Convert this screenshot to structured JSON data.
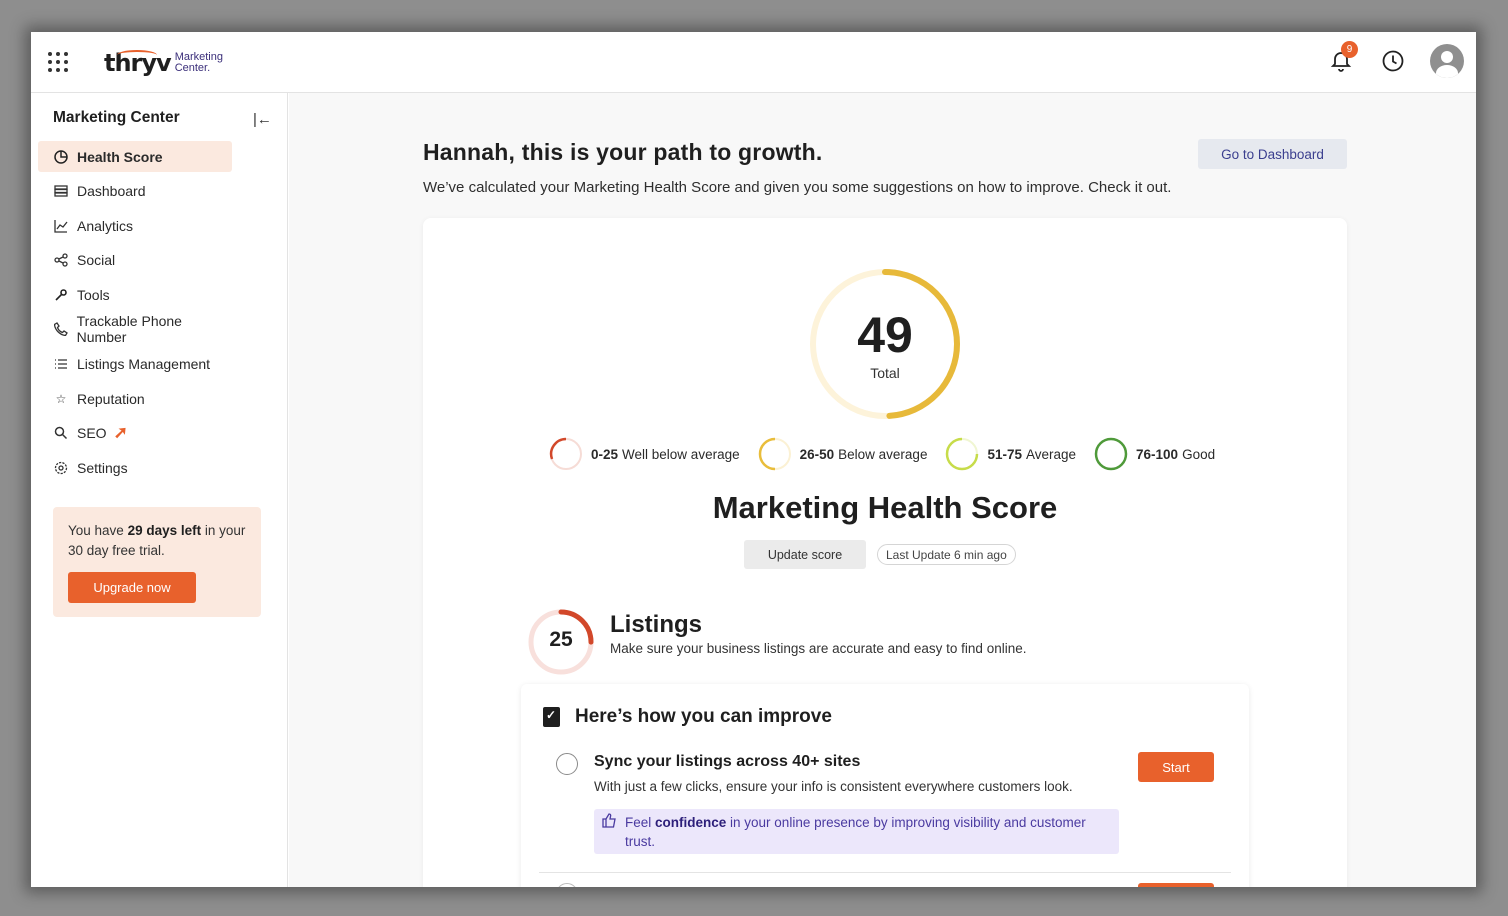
{
  "topbar": {
    "logo_word": "thryv",
    "logo_sub_1": "Marketing",
    "logo_sub_2": "Center.",
    "notification_count": "9",
    "icons": [
      "apps-grid-icon",
      "bell-icon",
      "clock-icon",
      "user-avatar-icon"
    ]
  },
  "sidebar": {
    "title": "Marketing Center",
    "items": [
      {
        "label": "Health Score",
        "icon": "health-score-icon",
        "active": true
      },
      {
        "label": "Dashboard",
        "icon": "dashboard-icon"
      },
      {
        "label": "Analytics",
        "icon": "analytics-icon"
      },
      {
        "label": "Social",
        "icon": "share-icon"
      },
      {
        "label": "Tools",
        "icon": "wrench-icon"
      },
      {
        "label": "Trackable Phone Number",
        "icon": "phone-icon"
      },
      {
        "label": "Listings Management",
        "icon": "list-icon"
      },
      {
        "label": "Reputation",
        "icon": "star-icon"
      },
      {
        "label": "SEO",
        "icon": "search-icon"
      },
      {
        "label": "Settings",
        "icon": "gear-icon"
      }
    ],
    "trial": {
      "text_pre": "You have ",
      "text_bold": "29 days left",
      "text_post": " in your 30 day free trial.",
      "button": "Upgrade now"
    }
  },
  "main": {
    "headline": "Hannah, this is your path to growth.",
    "subline": "We’ve calculated your Marketing Health Score and given you some suggestions on how to improve. Check it out.",
    "dashboard_button": "Go to Dashboard",
    "score": {
      "value": "49",
      "label": "Total",
      "fraction": 0.49
    },
    "legend": [
      {
        "range": "0-25",
        "label": "Well below average",
        "color": "#d2482a"
      },
      {
        "range": "26-50",
        "label": "Below average",
        "color": "#e9bd3b"
      },
      {
        "range": "51-75",
        "label": "Average",
        "color": "#c7dc4a"
      },
      {
        "range": "76-100",
        "label": "Good",
        "color": "#4f9a3a"
      }
    ],
    "mhs_title": "Marketing Health Score",
    "update_button": "Update score",
    "last_update": "Last Update 6 min ago",
    "listings": {
      "score": "25",
      "fraction": 0.25,
      "title": "Listings",
      "desc": "Make sure your business listings are accurate and easy to find online."
    },
    "improve": {
      "title": "Here’s how you can improve",
      "task_title": "Sync your listings across 40+ sites",
      "task_desc": "With just a few clicks, ensure your info is consistent everywhere customers look.",
      "start_button": "Start",
      "tip_pre": "Feel ",
      "tip_bold": "confidence",
      "tip_post": " in your online presence by improving visibility and customer trust."
    }
  },
  "colors": {
    "accent": "#e8612c",
    "gauge_fill": "#e7b93a",
    "gauge_track": "#fdf3da",
    "listing_ring": "#d2482a",
    "listing_track": "#f8e0dc"
  }
}
